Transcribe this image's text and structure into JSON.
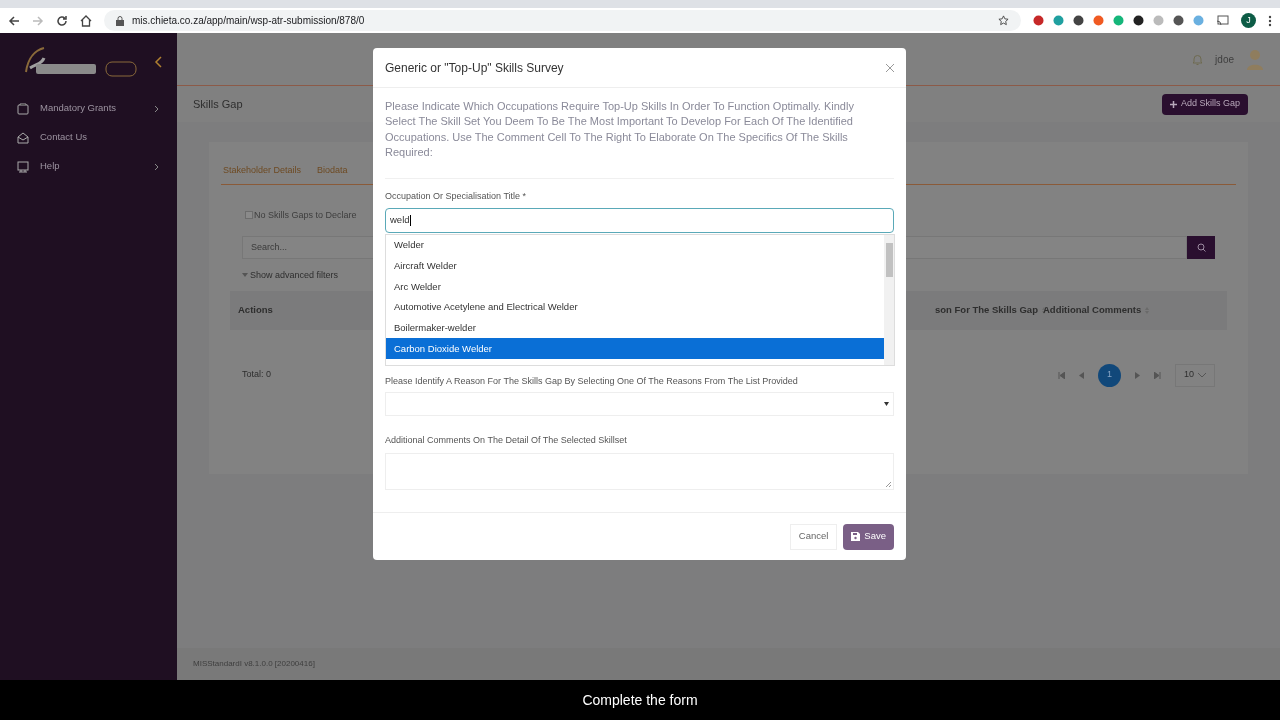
{
  "browser": {
    "url": "mis.chieta.co.za/app/main/wsp-atr-submission/878/0",
    "profile_initial": "J"
  },
  "sidebar": {
    "items": [
      {
        "label": "Mandatory Grants",
        "has_submenu": true
      },
      {
        "label": "Contact Us",
        "has_submenu": false
      },
      {
        "label": "Help",
        "has_submenu": true
      }
    ]
  },
  "header": {
    "user": "jdoe"
  },
  "page": {
    "title": "Skills Gap",
    "add_button": "Add Skills Gap",
    "tabs": [
      "Stakeholder Details",
      "Biodata"
    ],
    "no_gaps_checkbox": {
      "label": "No Skills Gaps to Declare",
      "checked": false
    },
    "search": {
      "placeholder": "Search..."
    },
    "advanced_filters": "Show advanced filters",
    "table": {
      "columns": [
        "Actions",
        "son For The Skills Gap",
        "Additional Comments"
      ],
      "total": "Total: 0"
    },
    "pagination": {
      "page": "1",
      "page_size": "10"
    },
    "footer": "MISStandardI v8.1.0.0 [20200416]"
  },
  "modal": {
    "title": "Generic or \"Top-Up\" Skills Survey",
    "instructions": "Please Indicate Which Occupations Require Top-Up Skills In Order To Function Optimally. Kindly Select The Skill Set You Deem To Be The Most Important To Develop For Each Of The Identified Occupations. Use The Comment Cell To The Right To Elaborate On The Specifics Of The Skills Required:",
    "occupation_field": {
      "label": "Occupation Or Specialisation Title *",
      "value": "weld"
    },
    "options": [
      {
        "label": "Welder",
        "selected": false
      },
      {
        "label": "Aircraft Welder",
        "selected": false
      },
      {
        "label": "Arc Welder",
        "selected": false
      },
      {
        "label": "Automotive Acetylene and Electrical Welder",
        "selected": false
      },
      {
        "label": "Boilermaker-welder",
        "selected": false
      },
      {
        "label": "Carbon Dioxide Welder",
        "selected": true
      }
    ],
    "reason_field": {
      "label": "Please Identify A Reason For The Skills Gap By Selecting One Of The Reasons From The List Provided"
    },
    "comments_field": {
      "label": "Additional Comments On The Detail Of The Selected Skillset"
    },
    "cancel_button": "Cancel",
    "save_button": "Save"
  },
  "caption": "Complete the form"
}
